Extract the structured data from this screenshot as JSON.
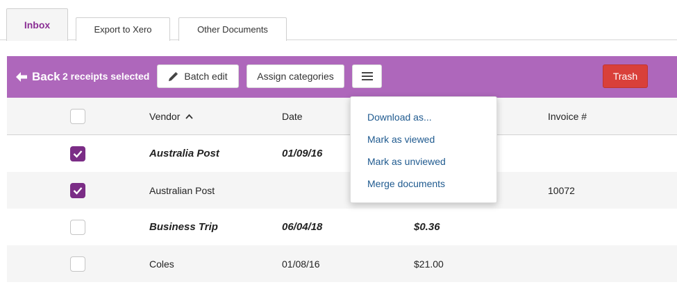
{
  "tabs": [
    {
      "label": "Inbox"
    },
    {
      "label": "Export to Xero"
    },
    {
      "label": "Other Documents"
    }
  ],
  "toolbar": {
    "back_label": "Back",
    "selected_label": "2 receipts selected",
    "batch_edit_label": "Batch edit",
    "assign_categories_label": "Assign categories",
    "menu_icon": "hamburger-icon",
    "trash_label": "Trash",
    "accent_color": "#ae67bb",
    "trash_color": "#d9403a"
  },
  "table": {
    "headers": {
      "vendor": "Vendor",
      "date": "Date",
      "invoice": "Invoice #"
    },
    "sort_icon": "chevron-up-icon",
    "rows": [
      {
        "vendor": "Australia Post",
        "date": "01/09/16",
        "amount": "",
        "invoice": "",
        "checked": true,
        "bold": true
      },
      {
        "vendor": "Australian Post",
        "date": "",
        "amount": "",
        "invoice": "10072",
        "checked": true,
        "bold": false
      },
      {
        "vendor": "Business Trip",
        "date": "06/04/18",
        "amount": "$0.36",
        "invoice": "",
        "checked": false,
        "bold": true
      },
      {
        "vendor": "Coles",
        "date": "01/08/16",
        "amount": "$21.00",
        "invoice": "",
        "checked": false,
        "bold": false
      }
    ]
  },
  "dropdown": {
    "items": [
      {
        "label": "Download as..."
      },
      {
        "label": "Mark as viewed"
      },
      {
        "label": "Mark as unviewed"
      },
      {
        "label": "Merge documents"
      }
    ]
  }
}
